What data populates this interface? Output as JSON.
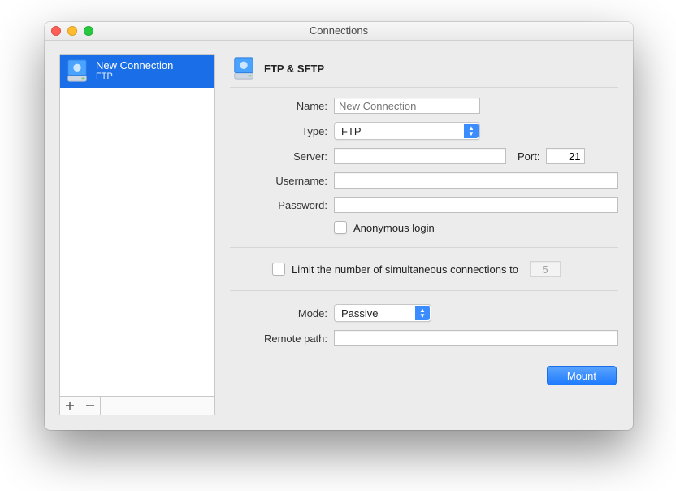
{
  "window": {
    "title": "Connections"
  },
  "sidebar": {
    "items": [
      {
        "name": "New Connection",
        "subtitle": "FTP",
        "selected": true
      }
    ],
    "add_tooltip": "Add",
    "remove_tooltip": "Remove"
  },
  "header": {
    "title": "FTP & SFTP"
  },
  "form": {
    "name_label": "Name:",
    "name_value": "",
    "name_placeholder": "New Connection",
    "type_label": "Type:",
    "type_value": "FTP",
    "server_label": "Server:",
    "server_value": "",
    "port_label": "Port:",
    "port_value": "21",
    "username_label": "Username:",
    "username_value": "",
    "password_label": "Password:",
    "password_value": "",
    "anonymous_label": "Anonymous login",
    "anonymous_checked": false,
    "limit_label": "Limit the number of simultaneous connections to",
    "limit_checked": false,
    "limit_value": "5",
    "mode_label": "Mode:",
    "mode_value": "Passive",
    "remote_label": "Remote path:",
    "remote_value": ""
  },
  "buttons": {
    "mount": "Mount"
  }
}
